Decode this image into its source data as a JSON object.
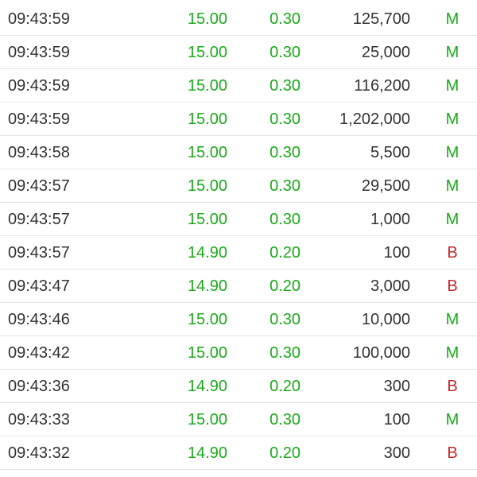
{
  "colors": {
    "up": "#1aaa1a",
    "side_m": "#1aaa1a",
    "side_b": "#c0282d",
    "text": "#333333",
    "divider": "#e6e6e6"
  },
  "trades": [
    {
      "time": "09:43:59",
      "price": "15.00",
      "change": "0.30",
      "volume": "125,700",
      "side": "M"
    },
    {
      "time": "09:43:59",
      "price": "15.00",
      "change": "0.30",
      "volume": "25,000",
      "side": "M"
    },
    {
      "time": "09:43:59",
      "price": "15.00",
      "change": "0.30",
      "volume": "116,200",
      "side": "M"
    },
    {
      "time": "09:43:59",
      "price": "15.00",
      "change": "0.30",
      "volume": "1,202,000",
      "side": "M"
    },
    {
      "time": "09:43:58",
      "price": "15.00",
      "change": "0.30",
      "volume": "5,500",
      "side": "M"
    },
    {
      "time": "09:43:57",
      "price": "15.00",
      "change": "0.30",
      "volume": "29,500",
      "side": "M"
    },
    {
      "time": "09:43:57",
      "price": "15.00",
      "change": "0.30",
      "volume": "1,000",
      "side": "M"
    },
    {
      "time": "09:43:57",
      "price": "14.90",
      "change": "0.20",
      "volume": "100",
      "side": "B"
    },
    {
      "time": "09:43:47",
      "price": "14.90",
      "change": "0.20",
      "volume": "3,000",
      "side": "B"
    },
    {
      "time": "09:43:46",
      "price": "15.00",
      "change": "0.30",
      "volume": "10,000",
      "side": "M"
    },
    {
      "time": "09:43:42",
      "price": "15.00",
      "change": "0.30",
      "volume": "100,000",
      "side": "M"
    },
    {
      "time": "09:43:36",
      "price": "14.90",
      "change": "0.20",
      "volume": "300",
      "side": "B"
    },
    {
      "time": "09:43:33",
      "price": "15.00",
      "change": "0.30",
      "volume": "100",
      "side": "M"
    },
    {
      "time": "09:43:32",
      "price": "14.90",
      "change": "0.20",
      "volume": "300",
      "side": "B"
    }
  ]
}
